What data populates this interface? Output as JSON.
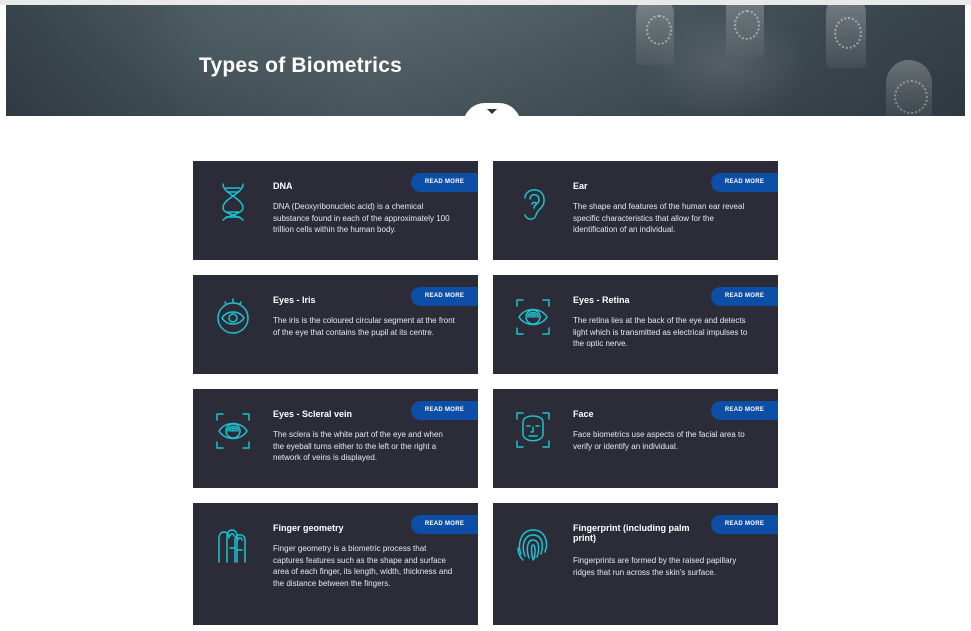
{
  "hero": {
    "title": "Types of Biometrics"
  },
  "cards": [
    {
      "title": "DNA",
      "desc": "DNA (Deoxyribonucleic acid) is a chemical substance found in each of the approximately 100 trillion cells within the human body.",
      "button": "READ MORE",
      "icon": "dna-icon"
    },
    {
      "title": "Ear",
      "desc": "The shape and features of the human ear reveal specific characteristics that allow for the identification of an individual.",
      "button": "READ MORE",
      "icon": "ear-icon"
    },
    {
      "title": "Eyes - Iris",
      "desc": "The iris is the coloured circular segment at the front of the eye that contains the pupil at its centre.",
      "button": "READ MORE",
      "icon": "iris-icon"
    },
    {
      "title": "Eyes - Retina",
      "desc": "The retina lies at the back of the eye and detects light which is transmitted as electrical impulses to the optic nerve.",
      "button": "READ MORE",
      "icon": "retina-icon"
    },
    {
      "title": "Eyes - Scleral vein",
      "desc": "The sclera is the white part of the eye and when the eyeball turns either to the left or the right a network of veins is displayed.",
      "button": "READ MORE",
      "icon": "scleral-vein-icon"
    },
    {
      "title": "Face",
      "desc": "Face biometrics use aspects of the facial area to verify or identify an individual.",
      "button": "READ MORE",
      "icon": "face-icon"
    },
    {
      "title": "Finger geometry",
      "desc": "Finger geometry is a biometric process that captures features such as the shape and surface area of each finger, its length, width, thickness and the distance between the fingers.",
      "button": "READ MORE",
      "icon": "finger-geometry-icon"
    },
    {
      "title": "Fingerprint (including palm print)",
      "desc": "Fingerprints are formed by the raised papillary ridges that run across the skin's surface.",
      "button": "READ MORE",
      "icon": "fingerprint-icon"
    }
  ],
  "colors": {
    "card_bg": "#2b2c37",
    "button_bg": "#0d4fa6",
    "icon_accent": "#1bc3cf"
  }
}
